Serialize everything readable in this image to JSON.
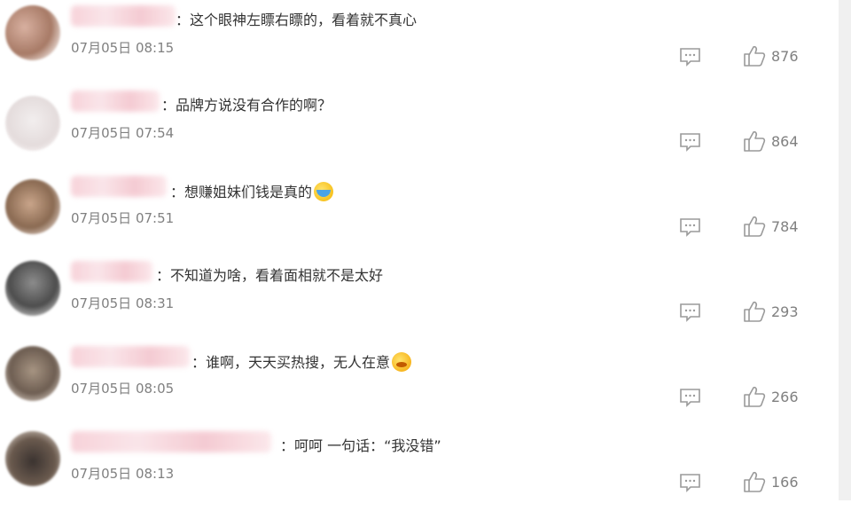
{
  "comments": [
    {
      "text": "：这个眼神左瞟右瞟的，看着就不真心",
      "time": "07月05日 08:15",
      "likes": "876",
      "emoji": ""
    },
    {
      "text": "：品牌方说没有合作的啊？",
      "time": "07月05日 07:54",
      "likes": "864",
      "emoji": ""
    },
    {
      "text": "：想赚姐妹们钱是真的",
      "time": "07月05日 07:51",
      "likes": "784",
      "emoji": "laughing-crying-emoji"
    },
    {
      "text": "：不知道为啥，看着面相就不是太好",
      "time": "07月05日 08:31",
      "likes": "293",
      "emoji": ""
    },
    {
      "text": "：谁啊，天天买热搜，无人在意",
      "time": "07月05日 08:05",
      "likes": "266",
      "emoji": "angry-emoji"
    },
    {
      "text": "：呵呵 一句话：“我没错”",
      "time": "07月05日 08:13",
      "likes": "166",
      "emoji": ""
    }
  ],
  "icons": {
    "reply": "comment-icon",
    "like": "thumbs-up-icon"
  },
  "colors": {
    "text": "#333333",
    "meta": "#808080",
    "icon": "#9a9a9a"
  }
}
